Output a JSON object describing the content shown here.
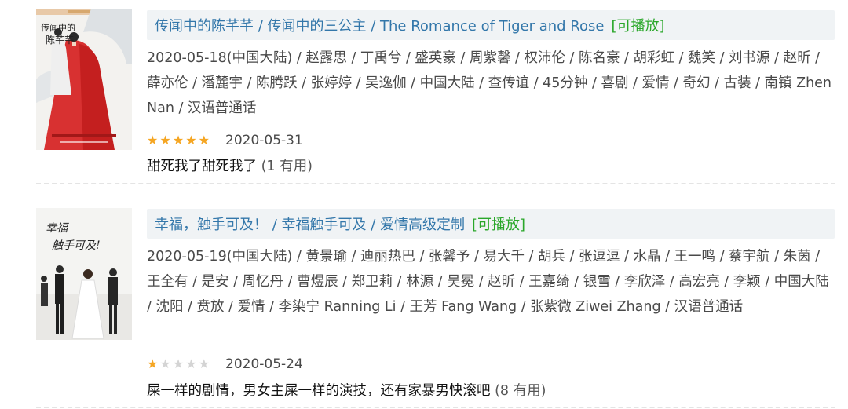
{
  "items": [
    {
      "poster_alt": "传闻中的陈芊芊 poster",
      "title": "传闻中的陈芊芊 / 传闻中的三公主 / The Romance of Tiger and Rose",
      "playable": "[可播放]",
      "intro": "2020-05-18(中国大陆) / 赵露思 / 丁禹兮 / 盛英豪 / 周紫馨 / 权沛伦 / 陈名豪 / 胡彩虹 / 魏笑 / 刘书源 / 赵昕 / 薛亦伦 / 潘麓宇 / 陈腾跃 / 张婷婷 / 吴逸伽 / 中国大陆 / 查传谊 / 45分钟 / 喜剧 / 爱情 / 奇幻 / 古装 / 南镇 Zhen Nan / 汉语普通话",
      "rating": 5,
      "rating_max": 5,
      "date": "2020-05-31",
      "comment": "甜死我了甜死我了",
      "useful": "(1 有用)"
    },
    {
      "poster_alt": "幸福，触手可及！ poster",
      "title": "幸福，触手可及！ / 幸福触手可及 / 爱情高级定制",
      "playable": "[可播放]",
      "intro": "2020-05-19(中国大陆) / 黄景瑜 / 迪丽热巴 / 张馨予 / 易大千 / 胡兵 / 张逗逗 / 水晶 / 王一鸣 / 蔡宇航 / 朱茵 / 王全有 / 是安 / 周忆丹 / 曹煜辰 / 郑卫莉 / 林源 / 吴冕 / 赵昕 / 王嘉绮 / 银雪 / 李欣泽 / 高宏亮 / 李颖 / 中国大陆 / 沈阳 / 贲放 / 爱情 / 李染宁 Ranning Li / 王芳 Fang Wang / 张紫微 Ziwei Zhang / 汉语普通话",
      "rating": 1,
      "rating_max": 5,
      "date": "2020-05-24",
      "comment": "屎一样的剧情，男女主屎一样的演技，还有家暴男快滚吧",
      "useful": "(8 有用)"
    }
  ],
  "colors": {
    "link": "#3377aa",
    "playable": "#2aa72a",
    "star_on": "#f5a623",
    "star_off": "#d4d4d4",
    "title_bg": "#f0f3f5"
  }
}
